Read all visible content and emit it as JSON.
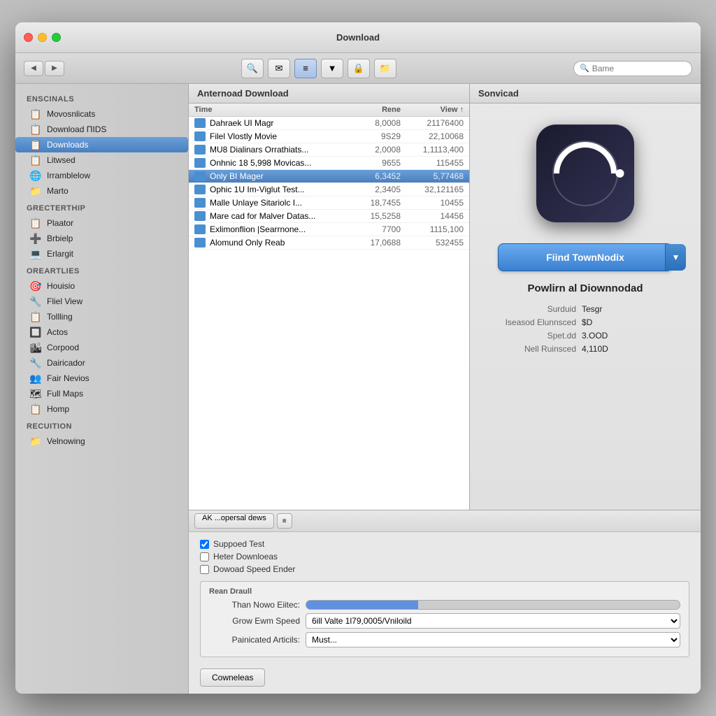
{
  "window": {
    "title": "Download"
  },
  "toolbar": {
    "back_label": "◀",
    "forward_label": "▶",
    "icon1": "🔍",
    "icon2": "✉",
    "icon3": "≡",
    "icon4": "▼",
    "icon5": "🔒",
    "icon6": "📁",
    "search_placeholder": "Bame"
  },
  "sidebar": {
    "section1": "Enscinals",
    "items1": [
      {
        "label": "Movosnlicats",
        "icon": "📋"
      },
      {
        "label": "Download ΠIDS",
        "icon": "📋"
      },
      {
        "label": "Downloads",
        "icon": "📋",
        "active": true
      },
      {
        "label": "Litwsed",
        "icon": "📋"
      },
      {
        "label": "Irramblelow",
        "icon": "🌐"
      },
      {
        "label": "Marto",
        "icon": "📁"
      }
    ],
    "section2": "Grecterthip",
    "items2": [
      {
        "label": "Plaator",
        "icon": "📋"
      },
      {
        "label": "Brbielp",
        "icon": "➕"
      },
      {
        "label": "Erlargit",
        "icon": "💻"
      }
    ],
    "section3": "Oreartlies",
    "items3": [
      {
        "label": "Houisio",
        "icon": "🎯"
      },
      {
        "label": "Fliel View",
        "icon": "🔧"
      },
      {
        "label": "Tollling",
        "icon": "📋"
      },
      {
        "label": "Actos",
        "icon": "🔲"
      },
      {
        "label": "Corpood",
        "icon": "🏙"
      },
      {
        "label": "Dairicador",
        "icon": "🔧"
      },
      {
        "label": "Fair Nevios",
        "icon": "👥"
      },
      {
        "label": "Full Maps",
        "icon": "🗺"
      },
      {
        "label": "Homp",
        "icon": "📋"
      }
    ],
    "section4": "Recuition",
    "items4": [
      {
        "label": "Velnowing",
        "icon": "📁"
      }
    ]
  },
  "file_list": {
    "header": "Anternoad Download",
    "sidebar_header": "Sonvicad",
    "columns": {
      "name": "Time",
      "rene": "Rene",
      "view": "View"
    },
    "rows": [
      {
        "name": "Dahraek UI Magr",
        "rene": "8,0008",
        "view": "21176400",
        "selected": false
      },
      {
        "name": "Filel Vlostly Movie",
        "rene": "9S29",
        "view": "22,10068",
        "selected": false
      },
      {
        "name": "MU8 Dialinars Orrathiats...",
        "rene": "2,0008",
        "view": "1,1113,400",
        "selected": false
      },
      {
        "name": "Onhnic 18 5,998 Movicas...",
        "rene": "9655",
        "view": "115455",
        "selected": false
      },
      {
        "name": "Only BI Mager",
        "rene": "6,3452",
        "view": "5,77468",
        "selected": true
      },
      {
        "name": "Ophic 1U Im-Viglut Test...",
        "rene": "2,3405",
        "view": "32,121165",
        "selected": false
      },
      {
        "name": "Malle Unlaye Sitariolc I...",
        "rene": "18,7455",
        "view": "10455",
        "selected": false
      },
      {
        "name": "Mare cad for Malver Datas...",
        "rene": "15,5258",
        "view": "14456",
        "selected": false
      },
      {
        "name": "Exlimonflion |Searrnone...",
        "rene": "7700",
        "view": "1115,100",
        "selected": false
      },
      {
        "name": "Alomund Only Reab",
        "rene": "17,0688",
        "view": "532455",
        "selected": false
      }
    ]
  },
  "bottom": {
    "tab_label": "AK ...opersal dews",
    "menu_icon": "≡",
    "checkboxes": [
      {
        "label": "Suppoed Test",
        "checked": true
      },
      {
        "label": "Heter Downloeas",
        "checked": false
      },
      {
        "label": "Dowoad Speed Ender",
        "checked": false
      }
    ],
    "section_title": "Rean Draull",
    "form_rows": [
      {
        "label": "Than Nowo Eiitec:",
        "type": "slider"
      },
      {
        "label": "Grow Ewm Speed",
        "type": "select",
        "value": "6ill Valte 1l79,0005/Vniloild"
      },
      {
        "label": "Painicated Articils:",
        "type": "select",
        "value": "Must..."
      }
    ],
    "download_btn": "Cowneleas"
  },
  "sidebar_panel": {
    "action_button": "Fiind TownNodix",
    "action_arrow": "▼",
    "info_title": "Powlirn al Diownnodad",
    "info_rows": [
      {
        "label": "Surduid",
        "value": "Tesgr"
      },
      {
        "label": "Iseasod Elunnsced",
        "value": "$D"
      },
      {
        "label": "Spet.dd",
        "value": "3.OOD"
      },
      {
        "label": "Nell Ruinsced",
        "value": "4,110D"
      }
    ]
  }
}
